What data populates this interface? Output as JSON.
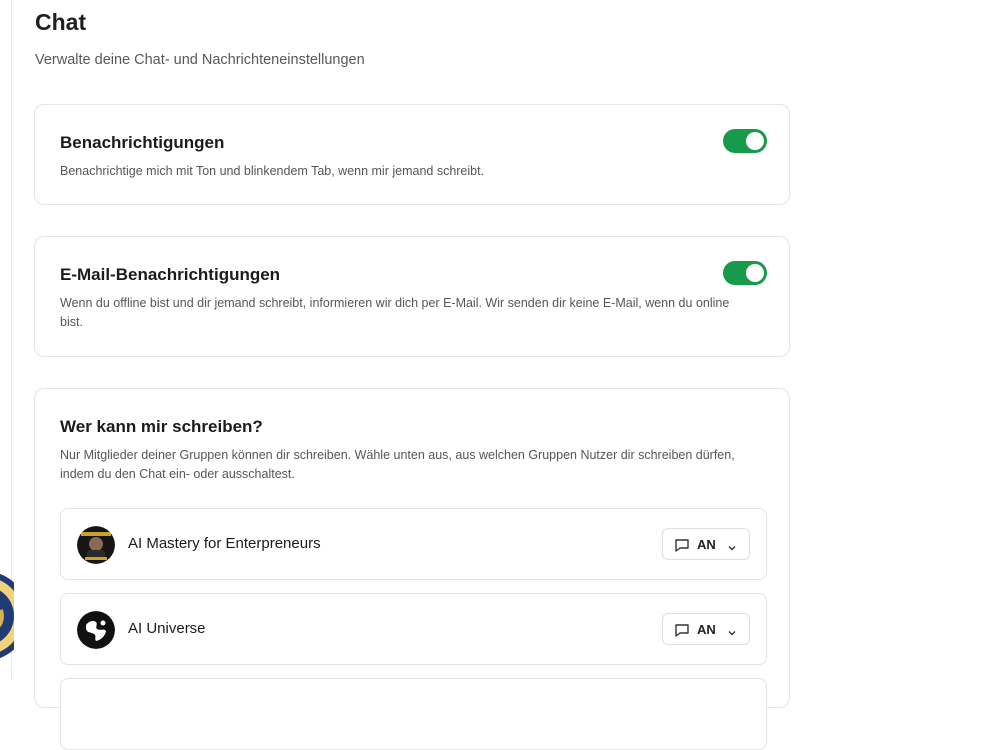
{
  "page": {
    "title": "Chat",
    "subtitle": "Verwalte deine Chat- und Nachrichteneinstellungen"
  },
  "settings": [
    {
      "title": "Benachrichtigungen",
      "description": "Benachrichtige mich mit Ton und blinkendem Tab, wenn mir jemand schreibt.",
      "enabled": true
    },
    {
      "title": "E-Mail-Benachrichtigungen",
      "description": "Wenn du offline bist und dir jemand schreibt, informieren wir dich per E-Mail. Wir senden dir keine E-Mail, wenn du online bist.",
      "enabled": true
    }
  ],
  "who_can_message": {
    "title": "Wer kann mir schreiben?",
    "description": "Nur Mitglieder deiner Gruppen können dir schreiben. Wähle unten aus, aus welchen Gruppen Nutzer dir schreiben dürfen, indem du den Chat ein- oder ausschaltest.",
    "groups": [
      {
        "name": "AI Mastery for Enterpreneurs",
        "chat_value": "AN",
        "avatar_icon": "group-avatar-photo"
      },
      {
        "name": "AI Universe",
        "chat_value": "AN",
        "avatar_icon": "globe-icon"
      },
      {
        "name": "",
        "chat_value": "",
        "avatar_icon": ""
      }
    ]
  },
  "colors": {
    "toggle_on": "#179a4a",
    "text_primary": "#1b1b1b",
    "text_secondary": "#545659",
    "border": "#e6e6e6"
  }
}
